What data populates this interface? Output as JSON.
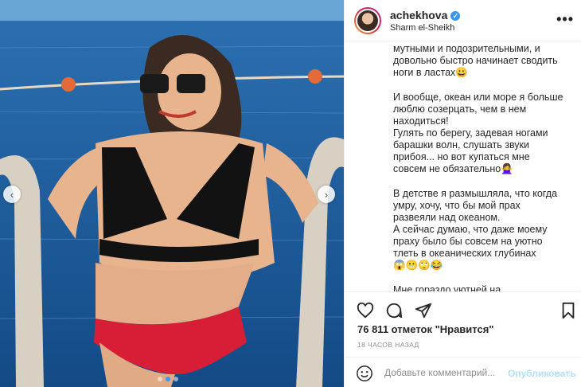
{
  "post": {
    "username": "achekhova",
    "location": "Sharm el-Sheikh",
    "more_label": "•••",
    "verified_mark": "✓"
  },
  "caption": {
    "lines_1": [
      "мутными и подозрительными, и",
      "довольно быстро начинает сводить",
      "ноги в ластах😀"
    ],
    "lines_2": [
      "И вообще, океан или море я больше",
      "люблю созерцать, чем в нем",
      "находиться!",
      "Гулять по берегу, задевая ногами",
      "барашки волн, слушать звуки",
      "прибоя... но вот купаться мне",
      "совсем не обязательно🙅‍♀️"
    ],
    "lines_3": [
      "В детстве я размышляла, что когда",
      "умру, хочу, что бы мой прах",
      "развеяли над океаном.",
      "А сейчас думаю, что даже моему",
      "праху было бы совсем на уютно",
      "тлеть в океанических глубинах",
      "😱😬🙄😂"
    ],
    "lines_4": [
      "Мне гораздо уютней на"
    ]
  },
  "stats": {
    "likes": "76 811 отметок \"Нравится\"",
    "time": "18 ЧАСОВ НАЗАД"
  },
  "comment": {
    "placeholder": "Добавьте комментарий...",
    "publish_label": "Опубликовать"
  },
  "carousel": {
    "prev_label": "‹",
    "next_label": "›",
    "slide_count": 3,
    "active_index": 1
  },
  "colors": {
    "accent": "#3897f0",
    "publish_disabled": "#b2dffc"
  },
  "icons": [
    "heart-icon",
    "comment-icon",
    "share-icon",
    "bookmark-icon",
    "emoji-icon"
  ]
}
